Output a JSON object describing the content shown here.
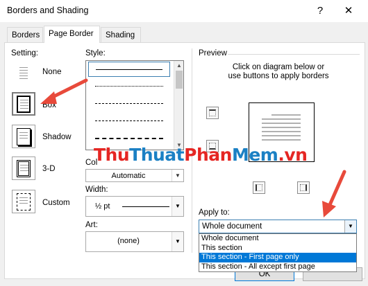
{
  "window": {
    "title": "Borders and Shading",
    "help": "?",
    "close": "✕"
  },
  "tabs": [
    {
      "label": "Borders"
    },
    {
      "label": "Page Border"
    },
    {
      "label": "Shading"
    }
  ],
  "setting": {
    "heading": "Setting:",
    "items": [
      {
        "label": "None"
      },
      {
        "label": "Box"
      },
      {
        "label": "Shadow"
      },
      {
        "label": "3-D"
      },
      {
        "label": "Custom"
      }
    ]
  },
  "style": {
    "heading": "Style:"
  },
  "color": {
    "heading": "Col",
    "value": "Automatic"
  },
  "width": {
    "heading": "Width:",
    "value": "½ pt"
  },
  "art": {
    "heading": "Art:",
    "value": "(none)"
  },
  "preview": {
    "heading": "Preview",
    "instruction_line1": "Click on diagram below or",
    "instruction_line2": "use buttons to apply borders"
  },
  "apply_to": {
    "heading": "Apply to:",
    "value": "Whole document",
    "options": [
      "Whole document",
      "This section",
      "This section - First page only",
      "This section - All except first page"
    ],
    "highlighted_index": 2
  },
  "buttons": {
    "ok": "OK"
  },
  "watermark": {
    "part1": "Thu",
    "part2": "Thuat",
    "part3": "Phan",
    "part4": "Mem",
    "part5": ".vn"
  },
  "colors": {
    "accent": "#0078d7",
    "arrow": "#e84a3b",
    "watermark_red": "#e52623",
    "watermark_blue": "#1b80c4"
  }
}
